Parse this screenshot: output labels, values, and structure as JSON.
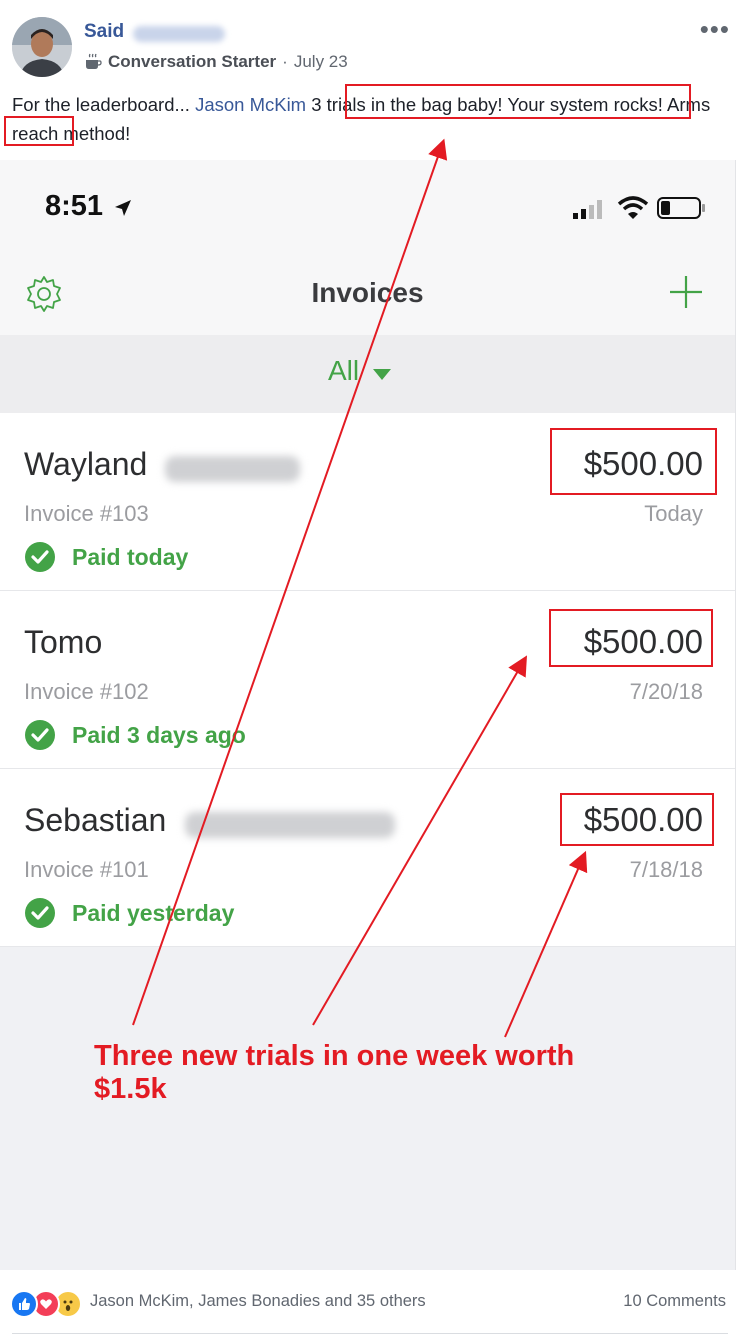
{
  "post": {
    "author_name": "Said",
    "badge_icon": "coffee-cup-icon",
    "badge_label": "Conversation Starter",
    "separator": "·",
    "date": "July 23",
    "more_icon": "more-options-icon",
    "more_glyph": "•••",
    "text_prefix": "For the leaderboard...",
    "mention": "Jason McKim",
    "text_highlight_1": "3 trials in the bag baby! Your system",
    "text_highlight_2": "rocks!",
    "text_suffix": "Arms reach method!"
  },
  "phone": {
    "status_time": "8:51",
    "nav_title": "Invoices",
    "filter_label": "All",
    "settings_icon": "gear-icon",
    "add_icon": "plus-icon",
    "invoices": [
      {
        "customer": "Wayland",
        "amount": "$500.00",
        "invoice_no": "Invoice #103",
        "date": "Today",
        "status": "Paid today"
      },
      {
        "customer": "Tomo",
        "amount": "$500.00",
        "invoice_no": "Invoice #102",
        "date": "7/20/18",
        "status": "Paid 3 days ago"
      },
      {
        "customer": "Sebastian",
        "amount": "$500.00",
        "invoice_no": "Invoice #101",
        "date": "7/18/18",
        "status": "Paid yesterday"
      }
    ]
  },
  "annotation": {
    "text": "Three new trials in one week worth $1.5k",
    "color": "#e31b23"
  },
  "footer": {
    "reaction_icons": [
      "like-icon",
      "love-icon",
      "wow-icon"
    ],
    "reactions_text": "Jason McKim, James Bonadies and 35 others",
    "comments": "10 Comments"
  },
  "colors": {
    "link": "#385898",
    "paid_green": "#43a347",
    "annotation_red": "#e31b23"
  }
}
